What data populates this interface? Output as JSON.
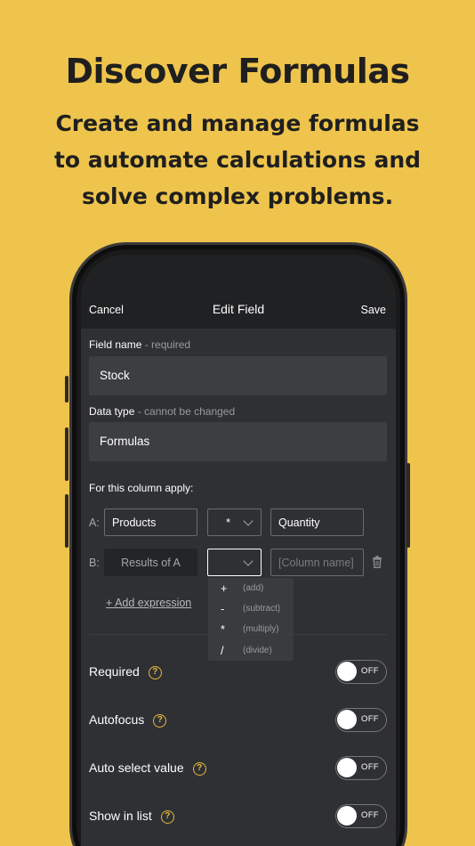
{
  "promo": {
    "title": "Discover Formulas",
    "subtitle_line1": "Create and manage formulas",
    "subtitle_line2": "to automate calculations and",
    "subtitle_line3": "solve complex problems."
  },
  "navbar": {
    "cancel": "Cancel",
    "title": "Edit Field",
    "save": "Save"
  },
  "field_name": {
    "label": "Field name",
    "hint": "- required",
    "value": "Stock"
  },
  "data_type": {
    "label": "Data type",
    "hint": "- cannot be changed",
    "value": "Formulas"
  },
  "apply": {
    "label": "For this column apply:",
    "row_a": {
      "letter": "A:",
      "left": "Products",
      "operator": "*",
      "right": "Quantity"
    },
    "row_b": {
      "letter": "B:",
      "left": "Results of A",
      "operator": "",
      "right_placeholder": "[Column name]"
    },
    "add_expression": "+ Add expression"
  },
  "operator_menu": [
    {
      "symbol": "+",
      "desc": "(add)"
    },
    {
      "symbol": "-",
      "desc": "(subtract)"
    },
    {
      "symbol": "*",
      "desc": "(multiply)"
    },
    {
      "symbol": "/",
      "desc": "(divide)"
    }
  ],
  "options": [
    {
      "label": "Required",
      "state": "OFF"
    },
    {
      "label": "Autofocus",
      "state": "OFF"
    },
    {
      "label": "Auto select value",
      "state": "OFF"
    },
    {
      "label": "Show in list",
      "state": "OFF"
    }
  ],
  "help_glyph": "?",
  "icons": {
    "help": "question-circle-icon",
    "delete": "trash-icon",
    "dropdown": "chevron-down-icon"
  },
  "colors": {
    "background": "#EEC44C",
    "screen": "#2f3033",
    "accent": "#E4B93F"
  }
}
